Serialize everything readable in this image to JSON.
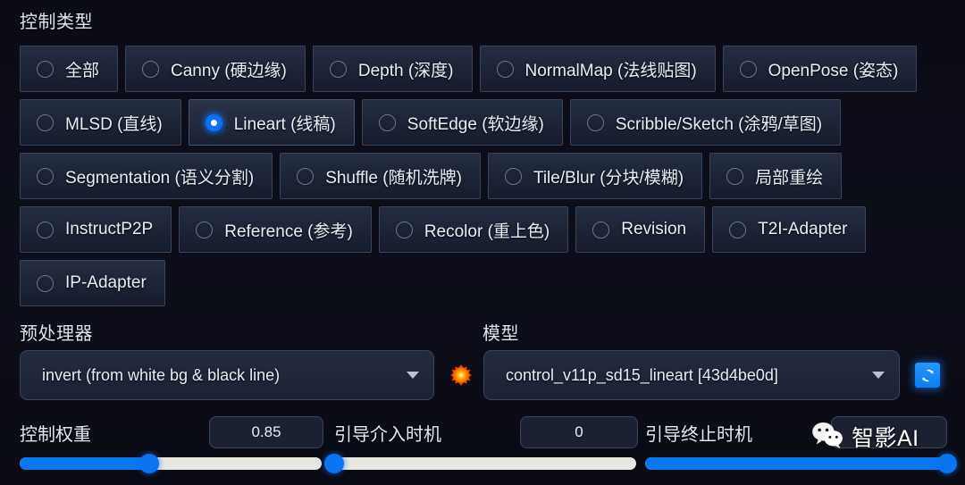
{
  "section": {
    "control_type_label": "控制类型",
    "preprocessor_label": "预处理器",
    "model_label": "模型"
  },
  "control_types": {
    "selected": "Lineart (线稿)",
    "rows": [
      [
        {
          "label": "全部",
          "selected": false
        },
        {
          "label": "Canny (硬边缘)",
          "selected": false
        },
        {
          "label": "Depth (深度)",
          "selected": false
        },
        {
          "label": "NormalMap (法线贴图)",
          "selected": false
        },
        {
          "label": "OpenPose (姿态)",
          "selected": false
        }
      ],
      [
        {
          "label": "MLSD (直线)",
          "selected": false
        },
        {
          "label": "Lineart (线稿)",
          "selected": true
        },
        {
          "label": "SoftEdge (软边缘)",
          "selected": false
        },
        {
          "label": "Scribble/Sketch (涂鸦/草图)",
          "selected": false
        }
      ],
      [
        {
          "label": "Segmentation (语义分割)",
          "selected": false
        },
        {
          "label": "Shuffle (随机洗牌)",
          "selected": false
        },
        {
          "label": "Tile/Blur (分块/模糊)",
          "selected": false
        },
        {
          "label": "局部重绘",
          "selected": false
        }
      ],
      [
        {
          "label": "InstructP2P",
          "selected": false
        },
        {
          "label": "Reference (参考)",
          "selected": false
        },
        {
          "label": "Recolor (重上色)",
          "selected": false
        },
        {
          "label": "Revision",
          "selected": false
        },
        {
          "label": "T2I-Adapter",
          "selected": false
        }
      ],
      [
        {
          "label": "IP-Adapter",
          "selected": false
        }
      ]
    ]
  },
  "preprocessor": {
    "value": "invert (from white bg & black line)",
    "icon": "explosion-icon"
  },
  "model": {
    "value": "control_v11p_sd15_lineart [43d4be0d]",
    "refresh_icon": "refresh-icon"
  },
  "sliders": [
    {
      "label": "控制权重",
      "value": "0.85",
      "percent": 43
    },
    {
      "label": "引导介入时机",
      "value": "0",
      "percent": 0
    },
    {
      "label": "引导终止时机",
      "value": "1",
      "percent": 100
    }
  ],
  "watermark": {
    "icon": "wechat-icon",
    "text": "智影AI"
  },
  "colors": {
    "accent": "#0a77f2",
    "background": "#0c0d17",
    "button_border": "#39435d",
    "explosion": "#ff5a00",
    "track": "#e8e6e3"
  }
}
